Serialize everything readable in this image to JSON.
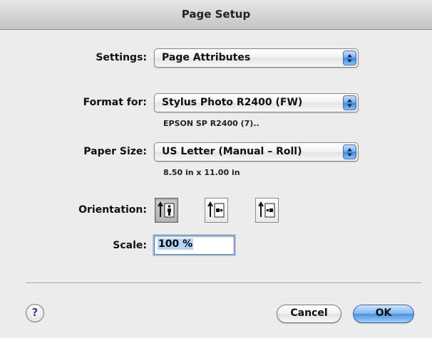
{
  "window": {
    "title": "Page Setup"
  },
  "settings": {
    "label": "Settings:",
    "value": "Page Attributes"
  },
  "format_for": {
    "label": "Format for:",
    "value": "Stylus Photo R2400 (FW)",
    "detail": "EPSON SP R2400 (7).."
  },
  "paper_size": {
    "label": "Paper Size:",
    "value": "US Letter (Manual – Roll)",
    "detail": "8.50 in x 11.00 in"
  },
  "orientation": {
    "label": "Orientation:",
    "options": [
      "portrait",
      "landscape-left",
      "landscape-right"
    ],
    "selected": "portrait"
  },
  "scale": {
    "label": "Scale:",
    "value": "100 %"
  },
  "buttons": {
    "help": "?",
    "cancel": "Cancel",
    "ok": "OK"
  },
  "colors": {
    "accent_blue": "#4a90e2",
    "window_bg": "#ececec"
  }
}
